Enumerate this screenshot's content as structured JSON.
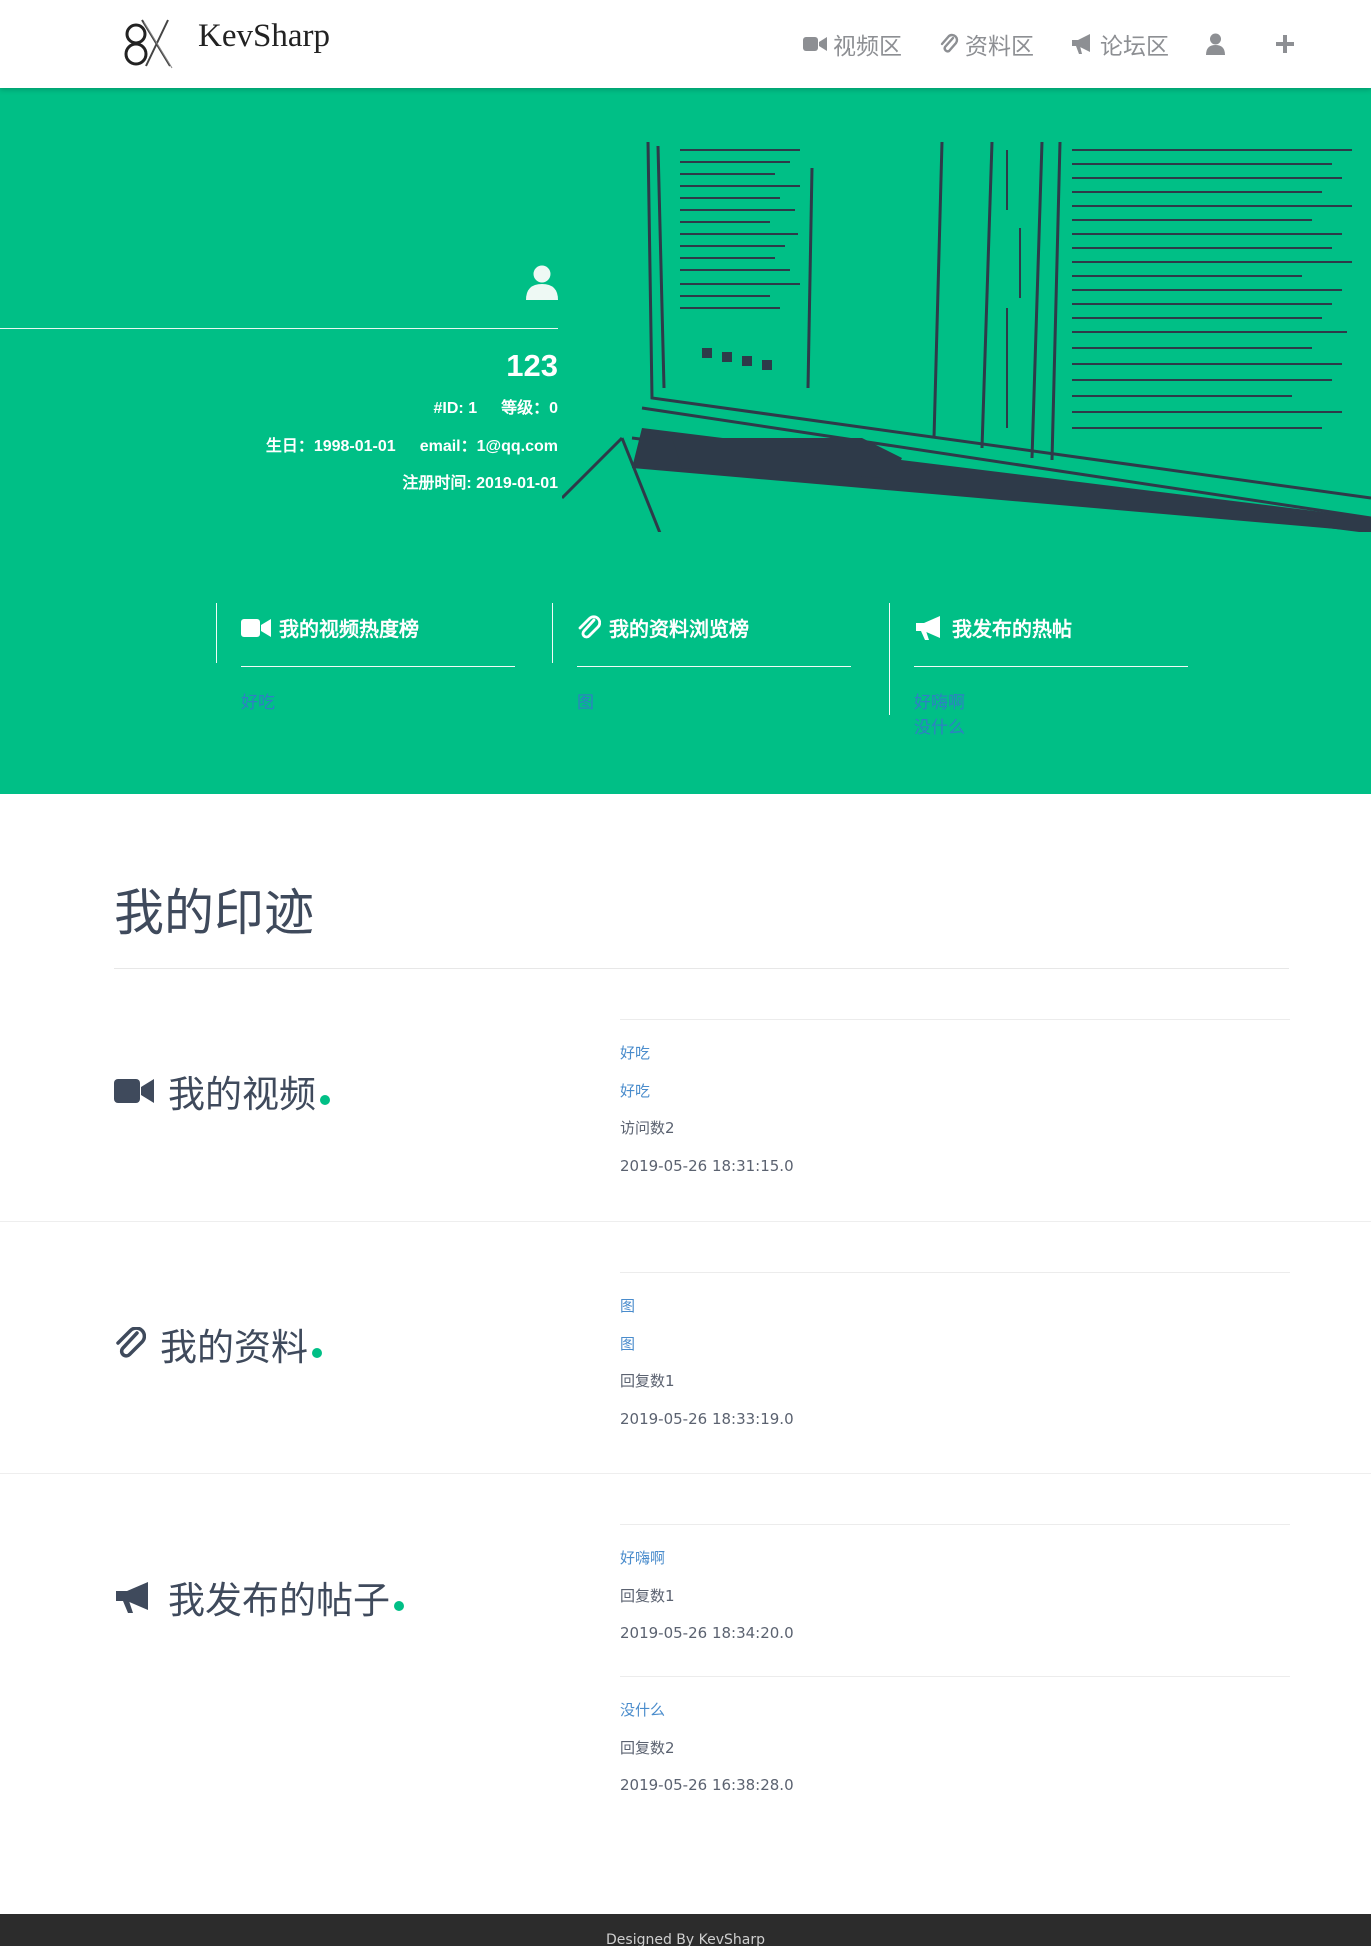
{
  "nav": {
    "brand": "KevSharp",
    "items": [
      {
        "label": "视频区",
        "icon": "video-camera-icon"
      },
      {
        "label": "资料区",
        "icon": "paperclip-icon"
      },
      {
        "label": "论坛区",
        "icon": "bullhorn-icon"
      }
    ],
    "user_icon": "user-icon",
    "add_icon": "plus-icon"
  },
  "profile": {
    "name": "123",
    "id_text": "#ID: 1",
    "level_text": "等级：0",
    "birthday_text": "生日：1998-01-01",
    "email_text": "email：1@qq.com",
    "register_text": "注册时间: 2019-01-01"
  },
  "boards": [
    {
      "title": "我的视频热度榜",
      "icon": "video-camera-icon",
      "links": [
        "好吃"
      ]
    },
    {
      "title": "我的资料浏览榜",
      "icon": "paperclip-icon",
      "links": [
        "图"
      ]
    },
    {
      "title": "我发布的热帖",
      "icon": "bullhorn-icon",
      "links": [
        "好嗨啊",
        "没什么"
      ]
    }
  ],
  "main": {
    "title": "我的印迹",
    "sections": [
      {
        "heading": "我的视频",
        "icon": "video-camera-icon",
        "entries": [
          {
            "lines": [
              "好吃",
              "好吃",
              "访问数2",
              "2019-05-26 18:31:15.0"
            ],
            "link_lines": 2
          }
        ]
      },
      {
        "heading": "我的资料",
        "icon": "paperclip-icon",
        "entries": [
          {
            "lines": [
              "图",
              "图",
              "回复数1",
              "2019-05-26 18:33:19.0"
            ],
            "link_lines": 2
          }
        ]
      },
      {
        "heading": "我发布的帖子",
        "icon": "bullhorn-icon",
        "entries": [
          {
            "lines": [
              "好嗨啊",
              "回复数1",
              "2019-05-26 18:34:20.0"
            ],
            "link_lines": 1
          },
          {
            "lines": [
              "没什么",
              "回复数2",
              "2019-05-26 16:38:28.0"
            ],
            "link_lines": 1
          }
        ]
      }
    ]
  },
  "footer": {
    "text": "Designed By KevSharp"
  },
  "colors": {
    "accent": "#00bf86",
    "text": "#3f4a5c",
    "link": "#4a8ccc",
    "nav_gray": "#8d8f93",
    "footer_bg": "#2c2c2c"
  }
}
